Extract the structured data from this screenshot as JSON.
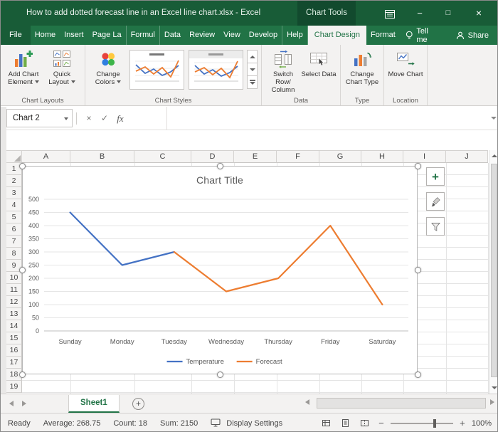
{
  "window": {
    "title": "How to add dotted forecast line in an Excel line chart.xlsx  -  Excel",
    "contextual_group": "Chart Tools",
    "controls": {
      "minimize": "−",
      "maximize": "□",
      "close": "×"
    }
  },
  "ribbon": {
    "tabs": [
      {
        "label": "File",
        "type": "file"
      },
      {
        "label": "Home"
      },
      {
        "label": "Insert"
      },
      {
        "label": "Page La"
      },
      {
        "label": "Formul"
      },
      {
        "label": "Data"
      },
      {
        "label": "Review"
      },
      {
        "label": "View"
      },
      {
        "label": "Develop"
      },
      {
        "label": "Help"
      },
      {
        "label": "Chart Design",
        "active": true
      },
      {
        "label": "Format"
      }
    ],
    "tell_me": "Tell me",
    "share": "Share",
    "buttons": {
      "add_chart_element": "Add Chart Element",
      "quick_layout": "Quick Layout",
      "change_colors": "Change Colors",
      "switch_row_column": "Switch Row/ Column",
      "select_data": "Select Data",
      "change_chart_type": "Change Chart Type",
      "move_chart": "Move Chart"
    },
    "group_labels": [
      "Chart Layouts",
      "Chart Styles",
      "Data",
      "Type",
      "Location"
    ]
  },
  "formula_bar": {
    "name_box": "Chart 2",
    "cancel": "×",
    "enter": "✓",
    "fx": "fx",
    "formula": ""
  },
  "grid": {
    "columns": [
      "A",
      "B",
      "C",
      "D",
      "E",
      "F",
      "G",
      "H",
      "I",
      "J"
    ],
    "rows": [
      "1",
      "2",
      "3",
      "4",
      "5",
      "6",
      "7",
      "8",
      "9",
      "10",
      "11",
      "12",
      "13",
      "14",
      "15",
      "16",
      "17",
      "18",
      "19"
    ]
  },
  "chart_data": {
    "type": "line",
    "title": "Chart Title",
    "categories": [
      "Sunday",
      "Monday",
      "Tuesday",
      "Wednesday",
      "Thursday",
      "Friday",
      "Saturday"
    ],
    "series": [
      {
        "name": "Temperature",
        "color": "#4472C4",
        "values": [
          450,
          250,
          300,
          null,
          null,
          null,
          null
        ]
      },
      {
        "name": "Forecast",
        "color": "#ED7D31",
        "values": [
          null,
          null,
          300,
          150,
          200,
          400,
          100
        ]
      }
    ],
    "ylim": [
      0,
      500
    ],
    "yticks": [
      0,
      50,
      100,
      150,
      200,
      250,
      300,
      350,
      400,
      450,
      500
    ],
    "grid": true,
    "legend_position": "bottom"
  },
  "sheet_bar": {
    "tabs": [
      {
        "label": "Sheet1",
        "active": true
      }
    ],
    "new_sheet": "+"
  },
  "status_bar": {
    "mode": "Ready",
    "aggregates": [
      "Average: 268.75",
      "Count: 18",
      "Sum: 2150"
    ],
    "display_settings": "Display Settings",
    "zoom_out": "−",
    "zoom_in": "+",
    "zoom_level": "100%"
  },
  "colors": {
    "titlebar_green": "#185c37",
    "ribbon_green": "#217346",
    "series1": "#4472C4",
    "series2": "#ED7D31"
  }
}
